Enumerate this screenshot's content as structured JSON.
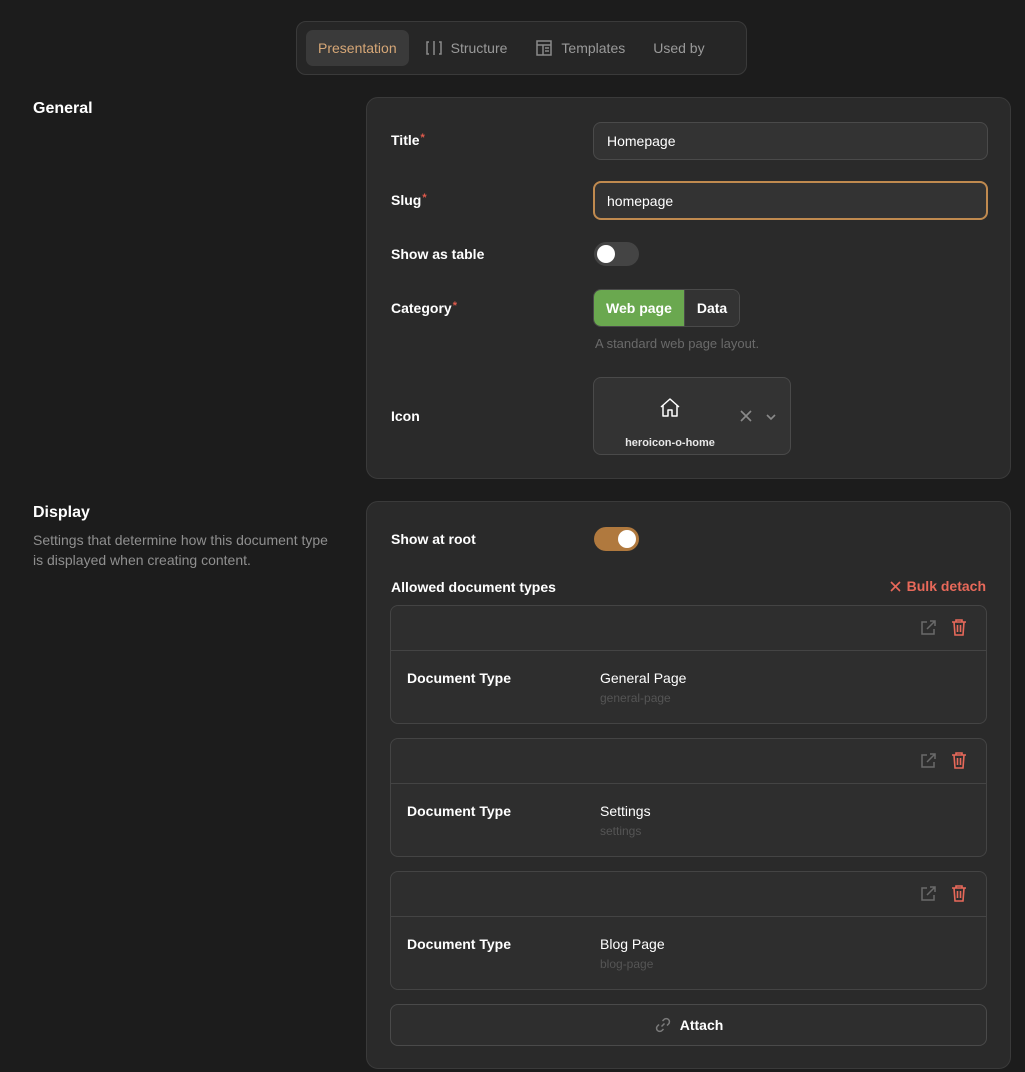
{
  "tabs": [
    {
      "label": "Presentation",
      "icon": "",
      "active": true
    },
    {
      "label": "Structure",
      "icon": "columns-icon"
    },
    {
      "label": "Templates",
      "icon": "template-icon"
    },
    {
      "label": "Used by",
      "icon": ""
    }
  ],
  "general": {
    "heading": "General",
    "title_label": "Title",
    "title_value": "Homepage",
    "slug_label": "Slug",
    "slug_value": "homepage",
    "show_as_table_label": "Show as table",
    "show_as_table": false,
    "category_label": "Category",
    "category_options": [
      "Web page",
      "Data"
    ],
    "category_selected": "Web page",
    "category_hint": "A standard web page layout.",
    "icon_label": "Icon",
    "icon_value": "heroicon-o-home"
  },
  "display": {
    "heading": "Display",
    "description": "Settings that determine how this document type is displayed when creating content.",
    "show_at_root_label": "Show at root",
    "show_at_root": true,
    "allowed_label": "Allowed document types",
    "bulk_detach_label": "Bulk detach",
    "document_types": [
      {
        "key": "Document Type",
        "name": "General Page",
        "slug": "general-page"
      },
      {
        "key": "Document Type",
        "name": "Settings",
        "slug": "settings"
      },
      {
        "key": "Document Type",
        "name": "Blog Page",
        "slug": "blog-page"
      }
    ],
    "attach_label": "Attach"
  },
  "colors": {
    "accent": "#d6a777",
    "toggle_on": "#b0793e",
    "category_active": "#6aa84f",
    "danger": "#e8695a"
  }
}
